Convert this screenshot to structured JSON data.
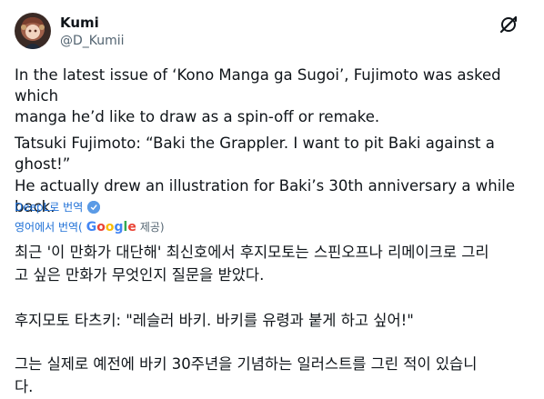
{
  "user": {
    "name": "Kumi",
    "handle": "@D_Kumii"
  },
  "tweet": {
    "p1_line1": "In the latest issue of ‘Kono Manga ga Sugoi’, Fujimoto was asked which",
    "p1_line2": "manga he’d like to draw as a spin-off or remake.",
    "p2": "Tatsuki Fujimoto: “Baki the Grappler. I want to pit Baki against a ghost!”",
    "p3": "He actually drew an illustration for Baki’s 30th anniversary a while back."
  },
  "translation": {
    "deepl_label": "DeepL로 번역",
    "google_prefix": "영어에서 번역(",
    "google_brand": [
      "G",
      "o",
      "o",
      "g",
      "l",
      "e"
    ],
    "google_suffix": " 제공)",
    "ko_p1_line1": "최근 '이 만화가 대단해' 최신호에서 후지모토는 스핀오프나 리메이크로 그리",
    "ko_p1_line2": "고 싶은 만화가 무엇인지 질문을 받았다.",
    "ko_p2": "후지모토 타츠키: \"레슬러 바키. 바키를 유령과 붙게 하고 싶어!\"",
    "ko_p3_line1": "그는 실제로 예전에 바키 30주년을 기념하는 일러스트를 그린 적이 있습니",
    "ko_p3_line2": "다."
  },
  "colors": {
    "text": "#0f1419",
    "muted": "#536471",
    "link": "#1d6fd6",
    "google": [
      "#4285F4",
      "#EA4335",
      "#FBBC05",
      "#4285F4",
      "#34A853",
      "#EA4335"
    ]
  },
  "icons": {
    "grok": "grok-icon",
    "deepl": "deepl-badge-icon"
  }
}
